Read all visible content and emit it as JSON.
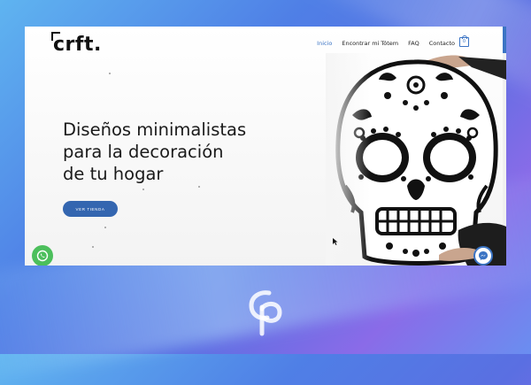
{
  "site": {
    "logo_text": "crft."
  },
  "nav": {
    "items": [
      {
        "label": "Inicio",
        "active": true
      },
      {
        "label": "Encontrar mi Tótem",
        "active": false
      },
      {
        "label": "FAQ",
        "active": false
      },
      {
        "label": "Contacto",
        "active": false
      }
    ],
    "cart_count": "0"
  },
  "hero": {
    "headline_line1": "Diseños minimalistas",
    "headline_line2": "para la decoración",
    "headline_line3": "de tu hogar",
    "cta_label": "VER TIENDA"
  },
  "icons": {
    "whatsapp": "whatsapp-icon",
    "messenger": "messenger-icon",
    "cart": "shopping-bag-icon",
    "skull": "sugar-skull-illustration"
  },
  "colors": {
    "accent": "#3b74c4",
    "button": "#3466b0",
    "whatsapp": "#4cbf5c"
  }
}
